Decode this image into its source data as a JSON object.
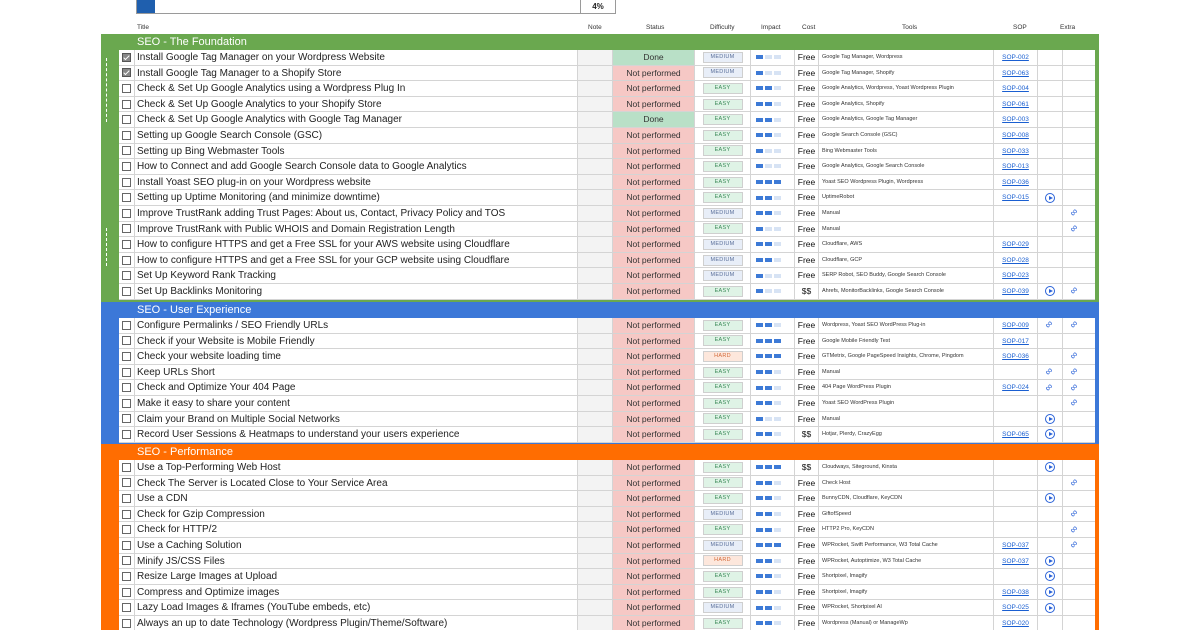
{
  "progress": {
    "label": "4%",
    "value": 0.04
  },
  "columns": {
    "title": "Title",
    "note": "Note",
    "status": "Status",
    "difficulty": "Difficulty",
    "impact": "Impact",
    "cost": "Cost",
    "tools": "Tools",
    "sop": "SOP",
    "extra": "Extra"
  },
  "colors": {
    "foundation": "#6aa84f",
    "ux": "#3c78d8",
    "performance": "#ff6d01",
    "link": "#1a5fd1"
  },
  "sections": [
    {
      "title": "SEO - The Foundation",
      "color": "#6aa84f",
      "rows": [
        {
          "done": true,
          "title": "Install Google Tag Manager on your Wordpress Website",
          "status": "Done",
          "difficulty": "MEDIUM",
          "impact": 1,
          "cost": "Free",
          "tools": "Google Tag Manager, Wordpress",
          "sop": "SOP-002",
          "e1": "",
          "e2": ""
        },
        {
          "done": true,
          "title": "Install Google Tag Manager to a Shopify Store",
          "status": "Not performed",
          "difficulty": "MEDIUM",
          "impact": 1,
          "cost": "Free",
          "tools": "Google Tag Manager, Shopify",
          "sop": "SOP-063",
          "e1": "",
          "e2": ""
        },
        {
          "done": false,
          "title": "Check & Set Up Google Analytics using a Wordpress Plug In",
          "status": "Not performed",
          "difficulty": "EASY",
          "impact": 2,
          "cost": "Free",
          "tools": "Google Analytics, Wordpress, Yoast Wordpress Plugin",
          "sop": "SOP-004",
          "e1": "",
          "e2": ""
        },
        {
          "done": false,
          "title": "Check & Set Up Google Analytics to your Shopify Store",
          "status": "Not performed",
          "difficulty": "EASY",
          "impact": 2,
          "cost": "Free",
          "tools": "Google Analytics, Shopify",
          "sop": "SOP-061",
          "e1": "",
          "e2": ""
        },
        {
          "done": false,
          "title": "Check & Set Up Google Analytics with Google Tag Manager",
          "status": "Done",
          "difficulty": "EASY",
          "impact": 2,
          "cost": "Free",
          "tools": "Google Analytics, Google Tag Manager",
          "sop": "SOP-003",
          "e1": "",
          "e2": ""
        },
        {
          "done": false,
          "title": "Setting up Google Search Console (GSC)",
          "status": "Not performed",
          "difficulty": "EASY",
          "impact": 2,
          "cost": "Free",
          "tools": "Google Search Console (GSC)",
          "sop": "SOP-008",
          "e1": "",
          "e2": ""
        },
        {
          "done": false,
          "title": "Setting up Bing Webmaster Tools",
          "status": "Not performed",
          "difficulty": "EASY",
          "impact": 1,
          "cost": "Free",
          "tools": "Bing Webmaster Tools",
          "sop": "SOP-033",
          "e1": "",
          "e2": ""
        },
        {
          "done": false,
          "title": "How to Connect and add Google Search Console data to Google Analytics",
          "status": "Not performed",
          "difficulty": "EASY",
          "impact": 1,
          "cost": "Free",
          "tools": "Google Analytics, Google Search Console",
          "sop": "SOP-013",
          "e1": "",
          "e2": ""
        },
        {
          "done": false,
          "title": "Install Yoast SEO plug-in on your Wordpress website",
          "status": "Not performed",
          "difficulty": "EASY",
          "impact": 3,
          "cost": "Free",
          "tools": "Yoast SEO Wordpress Plugin, Wordpress",
          "sop": "SOP-036",
          "e1": "",
          "e2": ""
        },
        {
          "done": false,
          "title": "Setting up Uptime Monitoring (and minimize downtime)",
          "status": "Not performed",
          "difficulty": "EASY",
          "impact": 2,
          "cost": "Free",
          "tools": "UptimeRobot",
          "sop": "SOP-015",
          "e1": "play",
          "e2": ""
        },
        {
          "done": false,
          "title": "Improve TrustRank adding Trust Pages: About us, Contact, Privacy Policy and TOS",
          "status": "Not performed",
          "difficulty": "MEDIUM",
          "impact": 2,
          "cost": "Free",
          "tools": "Manual",
          "sop": "",
          "e1": "",
          "e2": "link"
        },
        {
          "done": false,
          "title": "Improve TrustRank with Public WHOIS and Domain Registration Length",
          "status": "Not performed",
          "difficulty": "EASY",
          "impact": 1,
          "cost": "Free",
          "tools": "Manual",
          "sop": "",
          "e1": "",
          "e2": "link"
        },
        {
          "done": false,
          "title": "How to configure HTTPS and get a Free SSL for your AWS website using Cloudflare",
          "status": "Not performed",
          "difficulty": "MEDIUM",
          "impact": 2,
          "cost": "Free",
          "tools": "Cloudflare, AWS",
          "sop": "SOP-029",
          "e1": "",
          "e2": ""
        },
        {
          "done": false,
          "title": "How to configure HTTPS and get a Free SSL for your GCP website using Cloudflare",
          "status": "Not performed",
          "difficulty": "MEDIUM",
          "impact": 2,
          "cost": "Free",
          "tools": "Cloudflare, GCP",
          "sop": "SOP-028",
          "e1": "",
          "e2": ""
        },
        {
          "done": false,
          "title": "Set Up Keyword Rank Tracking",
          "status": "Not performed",
          "difficulty": "MEDIUM",
          "impact": 1,
          "cost": "Free",
          "tools": "SERP Robot, SEO Buddy, Google Search Console",
          "sop": "SOP-023",
          "e1": "",
          "e2": ""
        },
        {
          "done": false,
          "title": "Set Up Backlinks Monitoring",
          "status": "Not performed",
          "difficulty": "EASY",
          "impact": 1,
          "cost": "$$",
          "tools": "Ahrefs, MonitorBacklinks, Google Search Console",
          "sop": "SOP-039",
          "e1": "play",
          "e2": "link"
        }
      ]
    },
    {
      "title": "SEO - User Experience",
      "color": "#3c78d8",
      "rows": [
        {
          "done": false,
          "title": "Configure Permalinks / SEO Friendly URLs",
          "status": "Not performed",
          "difficulty": "EASY",
          "impact": 2,
          "cost": "Free",
          "tools": "Wordpress, Yoast SEO WordPress Plug-in",
          "sop": "SOP-009",
          "e1": "link",
          "e2": "link"
        },
        {
          "done": false,
          "title": "Check if your Website is Mobile Friendly",
          "status": "Not performed",
          "difficulty": "EASY",
          "impact": 3,
          "cost": "Free",
          "tools": "Google Mobile Friendly Test",
          "sop": "SOP-017",
          "e1": "",
          "e2": ""
        },
        {
          "done": false,
          "title": "Check your website loading time",
          "status": "Not performed",
          "difficulty": "HARD",
          "impact": 3,
          "cost": "Free",
          "tools": "GTMetrix, Google PageSpeed Insights, Chrome, Pingdom",
          "sop": "SOP-036",
          "e1": "",
          "e2": "link"
        },
        {
          "done": false,
          "title": "Keep URLs Short",
          "status": "Not performed",
          "difficulty": "EASY",
          "impact": 2,
          "cost": "Free",
          "tools": "Manual",
          "sop": "",
          "e1": "link",
          "e2": "link"
        },
        {
          "done": false,
          "title": "Check and Optimize Your 404 Page",
          "status": "Not performed",
          "difficulty": "EASY",
          "impact": 2,
          "cost": "Free",
          "tools": "404 Page WordPress Plugin",
          "sop": "SOP-024",
          "e1": "link",
          "e2": "link"
        },
        {
          "done": false,
          "title": "Make it easy to share your content",
          "status": "Not performed",
          "difficulty": "EASY",
          "impact": 2,
          "cost": "Free",
          "tools": "Yoast SEO WordPress Plugin",
          "sop": "",
          "e1": "",
          "e2": "link"
        },
        {
          "done": false,
          "title": "Claim your Brand on Multiple Social Networks",
          "status": "Not performed",
          "difficulty": "EASY",
          "impact": 1,
          "cost": "Free",
          "tools": "Manual",
          "sop": "",
          "e1": "play",
          "e2": ""
        },
        {
          "done": false,
          "title": "Record User Sessions & Heatmaps to understand your users experience",
          "status": "Not performed",
          "difficulty": "EASY",
          "impact": 2,
          "cost": "$$",
          "tools": "Hotjar, Plerdy, CrazyEgg",
          "sop": "SOP-065",
          "e1": "play",
          "e2": ""
        }
      ]
    },
    {
      "title": "SEO - Performance",
      "color": "#ff6d01",
      "rows": [
        {
          "done": false,
          "title": "Use a Top-Performing Web Host",
          "status": "Not performed",
          "difficulty": "EASY",
          "impact": 3,
          "cost": "$$",
          "tools": "Cloudways, Siteground, Kinsta",
          "sop": "",
          "e1": "play",
          "e2": ""
        },
        {
          "done": false,
          "title": "Check The Server is Located Close to Your Service Area",
          "status": "Not performed",
          "difficulty": "EASY",
          "impact": 2,
          "cost": "Free",
          "tools": "Check Host",
          "sop": "",
          "e1": "",
          "e2": "link"
        },
        {
          "done": false,
          "title": "Use a CDN",
          "status": "Not performed",
          "difficulty": "EASY",
          "impact": 2,
          "cost": "Free",
          "tools": "BunnyCDN, Cloudflare, KeyCDN",
          "sop": "",
          "e1": "play",
          "e2": ""
        },
        {
          "done": false,
          "title": "Check for Gzip Compression",
          "status": "Not performed",
          "difficulty": "MEDIUM",
          "impact": 2,
          "cost": "Free",
          "tools": "GiftofSpeed",
          "sop": "",
          "e1": "",
          "e2": "link"
        },
        {
          "done": false,
          "title": "Check for HTTP/2",
          "status": "Not performed",
          "difficulty": "EASY",
          "impact": 2,
          "cost": "Free",
          "tools": "HTTP2 Pro, KeyCDN",
          "sop": "",
          "e1": "",
          "e2": "link"
        },
        {
          "done": false,
          "title": "Use a Caching Solution",
          "status": "Not performed",
          "difficulty": "MEDIUM",
          "impact": 3,
          "cost": "Free",
          "tools": "WPRocket, Swift Performance, W3 Total Cache",
          "sop": "SOP-037",
          "e1": "",
          "e2": "link"
        },
        {
          "done": false,
          "title": "Minify JS/CSS Files",
          "status": "Not performed",
          "difficulty": "HARD",
          "impact": 2,
          "cost": "Free",
          "tools": "WPRocket, Autoptimize, W3 Total Cache",
          "sop": "SOP-037",
          "e1": "play",
          "e2": ""
        },
        {
          "done": false,
          "title": "Resize Large Images at Upload",
          "status": "Not performed",
          "difficulty": "EASY",
          "impact": 2,
          "cost": "Free",
          "tools": "Shortpixel, Imagify",
          "sop": "",
          "e1": "play",
          "e2": ""
        },
        {
          "done": false,
          "title": "Compress and Optimize images",
          "status": "Not performed",
          "difficulty": "EASY",
          "impact": 2,
          "cost": "Free",
          "tools": "Shortpixel, Imagify",
          "sop": "SOP-038",
          "e1": "play",
          "e2": ""
        },
        {
          "done": false,
          "title": "Lazy Load Images & Iframes (YouTube embeds, etc)",
          "status": "Not performed",
          "difficulty": "MEDIUM",
          "impact": 2,
          "cost": "Free",
          "tools": "WPRocket, Shortpixel AI",
          "sop": "SOP-025",
          "e1": "play",
          "e2": ""
        },
        {
          "done": false,
          "title": "Always an up to date Technology (Wordpress Plugin/Theme/Software)",
          "status": "Not performed",
          "difficulty": "EASY",
          "impact": 2,
          "cost": "Free",
          "tools": "Wordpress (Manual) or ManageWp",
          "sop": "SOP-020",
          "e1": "",
          "e2": ""
        }
      ]
    }
  ]
}
